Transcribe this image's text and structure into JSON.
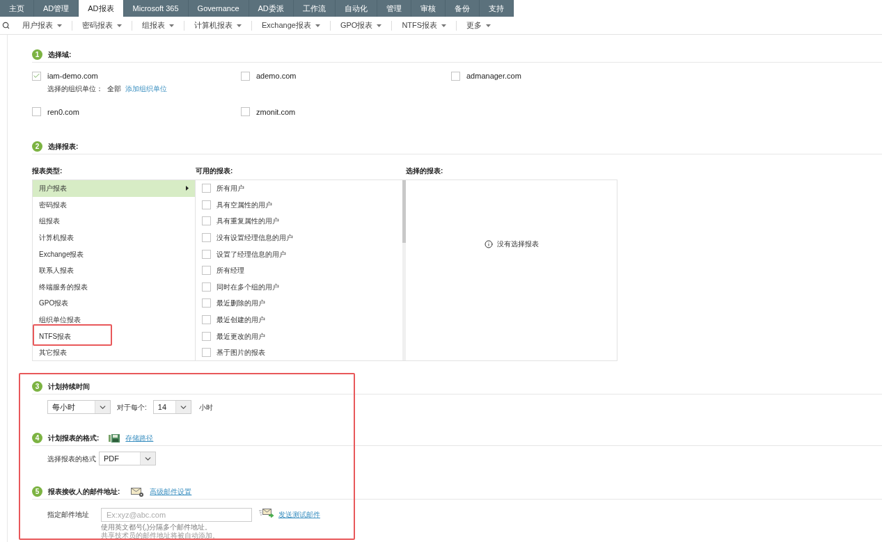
{
  "top_tabs": [
    {
      "label": "主页",
      "selected": false
    },
    {
      "label": "AD管理",
      "selected": false
    },
    {
      "label": "AD报表",
      "selected": true
    },
    {
      "label": "Microsoft 365",
      "selected": false
    },
    {
      "label": "Governance",
      "selected": false
    },
    {
      "label": "AD委派",
      "selected": false
    },
    {
      "label": "工作流",
      "selected": false
    },
    {
      "label": "自动化",
      "selected": false
    },
    {
      "label": "管理",
      "selected": false
    },
    {
      "label": "审核",
      "selected": false
    },
    {
      "label": "备份",
      "selected": false
    },
    {
      "label": "支持",
      "selected": false
    }
  ],
  "menu_bar": {
    "items": [
      "用户报表",
      "密码报表",
      "组报表",
      "计算机报表",
      "Exchange报表",
      "GPO报表",
      "NTFS报表",
      "更多"
    ]
  },
  "domain_section": {
    "number": "1",
    "title": "选择域:",
    "domains": [
      {
        "name": "iam-demo.com",
        "checked": true,
        "ou_label": "选择的组织单位：",
        "ou_value": "全部",
        "ou_link": "添加组织单位"
      },
      {
        "name": "ademo.com",
        "checked": false
      },
      {
        "name": "admanager.com",
        "checked": false
      },
      {
        "name": "ren0.com",
        "checked": false
      },
      {
        "name": "zmonit.com",
        "checked": false
      }
    ]
  },
  "report_section": {
    "number": "2",
    "title": "选择报表:",
    "type_header": "报表类型:",
    "available_header": "可用的报表:",
    "selected_header": "选择的报表:",
    "report_types": [
      {
        "label": "用户报表",
        "selected": true,
        "highlighted": false
      },
      {
        "label": "密码报表",
        "selected": false,
        "highlighted": false
      },
      {
        "label": "组报表",
        "selected": false,
        "highlighted": false
      },
      {
        "label": "计算机报表",
        "selected": false,
        "highlighted": false
      },
      {
        "label": "Exchange报表",
        "selected": false,
        "highlighted": false
      },
      {
        "label": "联系人报表",
        "selected": false,
        "highlighted": false
      },
      {
        "label": "终端服务的报表",
        "selected": false,
        "highlighted": false
      },
      {
        "label": "GPO报表",
        "selected": false,
        "highlighted": false
      },
      {
        "label": "组织单位报表",
        "selected": false,
        "highlighted": false
      },
      {
        "label": "NTFS报表",
        "selected": false,
        "highlighted": true
      },
      {
        "label": "其它报表",
        "selected": false,
        "highlighted": false
      }
    ],
    "available_reports": [
      {
        "label": "所有用户",
        "checked": false
      },
      {
        "label": "具有空属性的用户",
        "checked": false
      },
      {
        "label": "具有重复属性的用户",
        "checked": false
      },
      {
        "label": "没有设置经理信息的用户",
        "checked": false
      },
      {
        "label": "设置了经理信息的用户",
        "checked": false
      },
      {
        "label": "所有经理",
        "checked": false
      },
      {
        "label": "同时在多个组的用户",
        "checked": false
      },
      {
        "label": "最近删除的用户",
        "checked": false
      },
      {
        "label": "最近创建的用户",
        "checked": false
      },
      {
        "label": "最近更改的用户",
        "checked": false
      },
      {
        "label": "基于图片的报表",
        "checked": false
      }
    ],
    "empty_message": "没有选择报表"
  },
  "schedule_section": {
    "number": "3",
    "title": "计划持续时间",
    "frequency": "每小时",
    "for_each_label": "对于每个:",
    "interval": "14",
    "unit": "小时"
  },
  "format_section": {
    "number": "4",
    "title": "计划报表的格式:",
    "storage_link": "存储路径",
    "format_label": "选择报表的格式",
    "format_value": "PDF"
  },
  "email_section": {
    "number": "5",
    "title": "报表接收人的邮件地址:",
    "advanced_link": "高级邮件设置",
    "address_label": "指定邮件地址",
    "placeholder": "Ex:xyz@abc.com",
    "test_link": "发送测试邮件",
    "hints": [
      "使用英文都号(,)分隔多个邮件地址。",
      "共享技术员的邮件地址将被自动添加。"
    ]
  }
}
